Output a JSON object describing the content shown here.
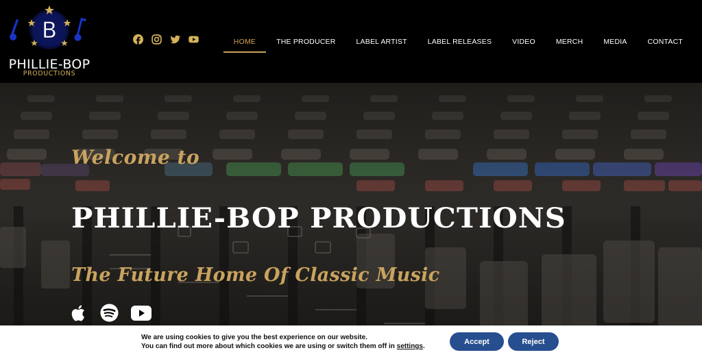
{
  "header": {
    "logo": {
      "title": "PHILLIE-BOP",
      "subtitle": "PRODUCTIONS",
      "emblem_letter": "B"
    },
    "socials": [
      {
        "name": "facebook-icon"
      },
      {
        "name": "instagram-icon"
      },
      {
        "name": "twitter-icon"
      },
      {
        "name": "youtube-icon"
      }
    ],
    "nav": [
      {
        "label": "HOME",
        "active": true
      },
      {
        "label": "THE PRODUCER"
      },
      {
        "label": "LABEL ARTIST"
      },
      {
        "label": "LABEL RELEASES"
      },
      {
        "label": "VIDEO"
      },
      {
        "label": "MERCH"
      },
      {
        "label": "MEDIA"
      },
      {
        "label": "CONTACT"
      }
    ]
  },
  "hero": {
    "welcome": "Welcome to",
    "title": "PHILLIE-BOP PRODUCTIONS",
    "tagline": "The Future Home Of Classic Music",
    "platform_icons": [
      "apple-icon",
      "spotify-icon",
      "youtube-icon"
    ]
  },
  "cookie": {
    "line1": "We are using cookies to give you the best experience on our website.",
    "line2_prefix": "You can find out more about which cookies we are using or switch them off in ",
    "line2_link": "settings",
    "line2_suffix": ".",
    "accept_label": "Accept",
    "reject_label": "Reject"
  },
  "colors": {
    "gold": "#c9a35e",
    "nav_active": "#d4a55a",
    "button_blue": "#274e8f",
    "header_bg": "#000000"
  }
}
